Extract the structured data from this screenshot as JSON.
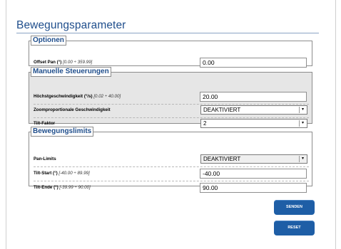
{
  "page": {
    "title": "Bewegungsparameter"
  },
  "sections": {
    "optionen": {
      "legend": "Optionen",
      "offset_pan": {
        "label": "Offset Pan (°)",
        "hint": "[0.00 ÷ 359.99]",
        "value": "0.00"
      }
    },
    "manuelle": {
      "legend": "Manuelle Steuerungen",
      "hoechst": {
        "label": "Höchstgeschwindigkeit (°/s)",
        "hint": "[0.02 ÷ 40.00]",
        "value": "20.00"
      },
      "zoomprop": {
        "label": "Zoomproportionale Geschwindigkeit",
        "value": "DEAKTIVIERT"
      },
      "tilt_faktor": {
        "label": "Tilt-Faktor",
        "value": "2"
      }
    },
    "limits": {
      "legend": "Bewegungslimits",
      "pan_limits": {
        "label": "Pan-Limits",
        "value": "DEAKTIVIERT"
      },
      "tilt_start": {
        "label": "Tilt-Start (°)",
        "hint": "[-40.00 ÷ 89.99]",
        "value": "-40.00"
      },
      "tilt_ende": {
        "label": "Tilt-Ende (°)",
        "hint": "[-39.99 ÷ 90.00]",
        "value": "90.00"
      }
    }
  },
  "buttons": {
    "senden": "SENDEN",
    "reset": "RESET"
  },
  "icons": {
    "dropdown": "dropdown-arrow-icon"
  },
  "colors": {
    "accent": "#1e5ea6",
    "title": "#1f4e8c"
  }
}
